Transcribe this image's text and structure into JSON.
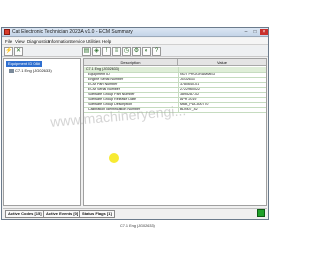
{
  "window": {
    "title": "Cat Electronic Technician 2023A v1.0 - ECM Summary"
  },
  "menu": [
    "File",
    "View",
    "Diagnostics",
    "Information",
    "Service",
    "Utilities",
    "Help"
  ],
  "toolbar": {
    "icons": [
      "connect-icon",
      "disconnect-icon",
      "summary-icon",
      "status-icon",
      "active-codes-icon",
      "logged-codes-icon",
      "events-icon",
      "config-icon",
      "calibrate-icon",
      "help-icon"
    ]
  },
  "tree": {
    "selected": "Equipment ID 08#",
    "child": "C7.1 Eng (JG02633)"
  },
  "grid": {
    "columns": {
      "description": "Description",
      "value": "Value"
    },
    "section": "C7.1 Eng (JG02633)",
    "rows": [
      {
        "description": "Equipment ID",
        "value": "NOT PROGRAMMED"
      },
      {
        "description": "Engine Serial Number",
        "value": "JG02633"
      },
      {
        "description": "ECM Part Number",
        "value": "3780640-01"
      },
      {
        "description": "ECM Serial Number",
        "value": "2722960022"
      },
      {
        "description": "Software Group Part Number",
        "value": "3895287-02"
      },
      {
        "description": "Software Group Release Date",
        "value": "APR 2019"
      },
      {
        "description": "Software Group Description",
        "value": "M6B_PDL300770"
      },
      {
        "description": "Calibration Identification Number",
        "value": "BDN07_42"
      }
    ]
  },
  "watermark": "www.machineryengi...",
  "bottom_tabs": [
    "Active Codes [15]",
    "Active Events [0]",
    "Status Flags [1]"
  ],
  "status": {
    "text": "C7.1 Eng (JG02633)",
    "indicator_color": "#1fa02a"
  }
}
